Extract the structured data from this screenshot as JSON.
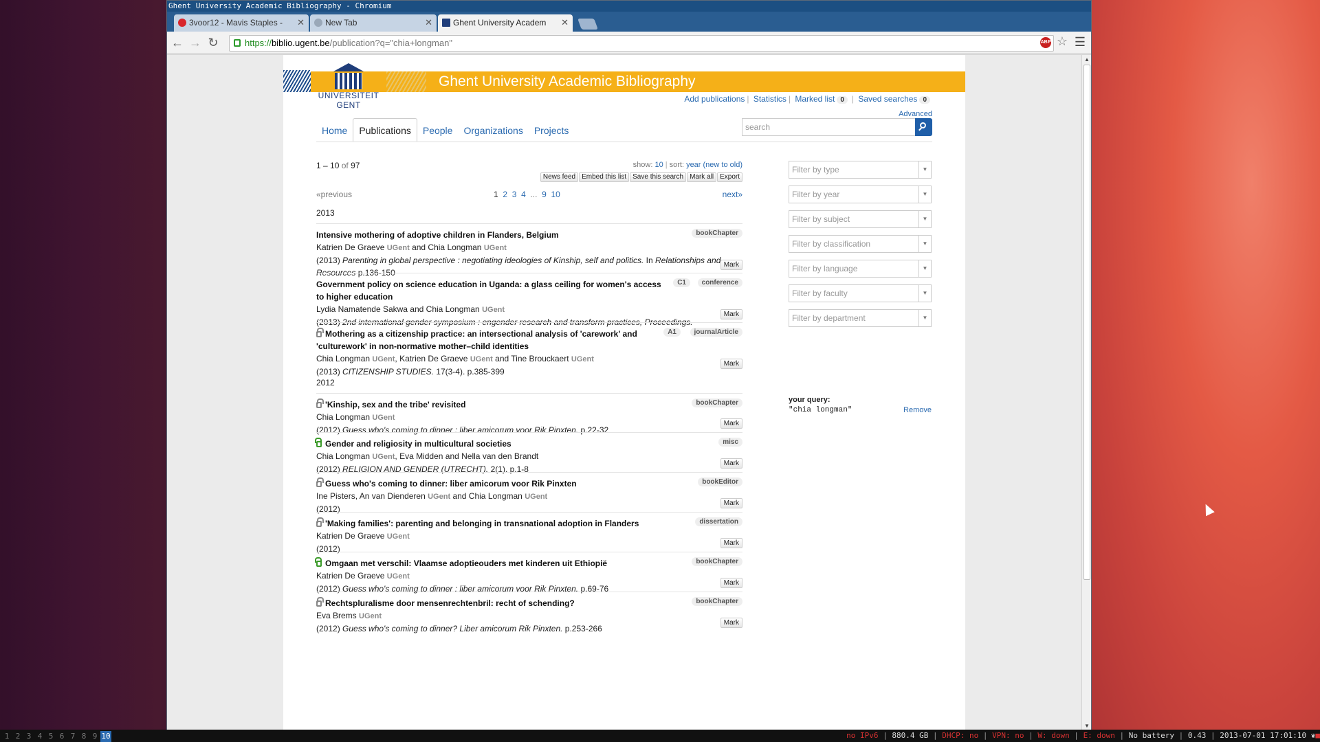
{
  "window": {
    "title": "Ghent University Academic Bibliography - Chromium"
  },
  "tabs": [
    {
      "label": "3voor12 - Mavis Staples -",
      "favicon_color": "#d8262c"
    },
    {
      "label": "New Tab",
      "favicon_color": "#9aa8b8"
    },
    {
      "label": "Ghent University Academ",
      "favicon_color": "#1f3d7a"
    }
  ],
  "omnibox": {
    "scheme": "https://",
    "host": "biblio.ugent.be",
    "path": "/publication?q=\"chia+longman\""
  },
  "site": {
    "title": "Ghent University Academic Bibliography",
    "logo_line1": "UNIVERSITEIT",
    "logo_line2": "GENT",
    "user_links": {
      "add": "Add publications",
      "stats": "Statistics",
      "marked": "Marked list",
      "marked_count": "0",
      "saved": "Saved searches",
      "saved_count": "0"
    },
    "advanced": "Advanced",
    "nav": [
      "Home",
      "Publications",
      "People",
      "Organizations",
      "Projects"
    ],
    "search_placeholder": "search"
  },
  "results": {
    "range_start": "1",
    "range_sep": " – ",
    "range_end": "10",
    "of": " of ",
    "total": "97",
    "show_label": "show:",
    "show_value": "10",
    "sort_label": "sort:",
    "sort_value": "year (new to old)",
    "buttons": [
      "News feed",
      "Embed this list",
      "Save this search",
      "Mark all",
      "Export"
    ],
    "pager": {
      "previous": "«previous",
      "next": "next»",
      "pages": [
        "1",
        "2",
        "3",
        "4",
        "...",
        "9",
        "10"
      ]
    },
    "mark_label": "Mark",
    "year_2013": "2013",
    "year_2012": "2012",
    "items": [
      {
        "title": "Intensive mothering of adoptive children in Flanders, Belgium",
        "authors": [
          [
            "Katrien De Graeve",
            "UGent"
          ],
          [
            " and Chia Longman",
            "UGent"
          ]
        ],
        "year": "(2013)",
        "source_italic": "Parenting in global perspective : negotiating ideologies of Kinship, self and politics.",
        "source_rest": " In ",
        "source_italic2": "Relationships and Resources",
        "pages": " p.136-150",
        "type": "bookChapter",
        "lock": "none"
      },
      {
        "title": "Government policy on science education in Uganda: a glass ceiling for women's access to higher education",
        "authors": [
          [
            "Lydia Namatende Sakwa and Chia Longman",
            "UGent"
          ]
        ],
        "year": "(2013)",
        "source_italic": "2nd international gender symposium : engender research and transform practices, Proceedings.",
        "type": "conference",
        "class": "C1",
        "lock": "none"
      },
      {
        "title": "Mothering as a citizenship practice: an intersectional analysis of 'carework' and 'culturework' in non-normative mother–child identities",
        "authors": [
          [
            "Chia Longman",
            "UGent"
          ],
          [
            ", Katrien De Graeve",
            "UGent"
          ],
          [
            " and Tine Brouckaert",
            "UGent"
          ]
        ],
        "year": "(2013)",
        "source_italic": "CITIZENSHIP STUDIES.",
        "pages": " 17(3-4). p.385-399",
        "type": "journalArticle",
        "class": "A1",
        "lock": "closed"
      },
      {
        "title": "'Kinship, sex and the tribe' revisited",
        "authors": [
          [
            "Chia Longman",
            "UGent"
          ]
        ],
        "year": "(2012)",
        "source_italic": "Guess who's coming to dinner : liber amicorum voor Rik Pinxten.",
        "pages": " p.22-32",
        "type": "bookChapter",
        "lock": "closed"
      },
      {
        "title": "Gender and religiosity in multicultural societies",
        "authors": [
          [
            "Chia Longman",
            "UGent"
          ],
          [
            ", Eva Midden and Nella van den Brandt",
            ""
          ]
        ],
        "year": "(2012)",
        "source_italic": "RELIGION AND GENDER (UTRECHT).",
        "pages": " 2(1). p.1-8",
        "type": "misc",
        "lock": "open"
      },
      {
        "title": "Guess who's coming to dinner: liber amicorum voor Rik Pinxten",
        "authors": [
          [
            "Ine Pisters, An van Dienderen",
            "UGent"
          ],
          [
            " and Chia Longman",
            "UGent"
          ]
        ],
        "year": "(2012)",
        "type": "bookEditor",
        "lock": "closed"
      },
      {
        "title": "'Making families': parenting and belonging in transnational adoption in Flanders",
        "authors": [
          [
            "Katrien De Graeve",
            "UGent"
          ]
        ],
        "year": "(2012)",
        "type": "dissertation",
        "lock": "closed"
      },
      {
        "title": "Omgaan met verschil: Vlaamse adoptieouders met kinderen uit Ethiopië",
        "authors": [
          [
            "Katrien De Graeve",
            "UGent"
          ]
        ],
        "year": "(2012)",
        "source_italic": "Guess who's coming to dinner : liber amicorum voor Rik Pinxten.",
        "pages": " p.69-76",
        "type": "bookChapter",
        "lock": "open"
      },
      {
        "title": "Rechtspluralisme door mensenrechtenbril: recht of schending?",
        "authors": [
          [
            "Eva Brems",
            "UGent"
          ]
        ],
        "year": "(2012)",
        "source_italic": "Guess who's coming to dinner? Liber amicorum Rik Pinxten.",
        "pages": " p.253-266",
        "type": "bookChapter",
        "lock": "closed"
      }
    ]
  },
  "filters": [
    "Filter by type",
    "Filter by year",
    "Filter by subject",
    "Filter by classification",
    "Filter by language",
    "Filter by faculty",
    "Filter by department"
  ],
  "query": {
    "label": "your query:",
    "value": "\"chia longman\"",
    "remove": "Remove"
  },
  "taskbar": {
    "workspaces": [
      "1",
      "2",
      "3",
      "4",
      "5",
      "6",
      "7",
      "8",
      "9",
      "10"
    ],
    "active_workspace": "10",
    "ipv6": "no IPv6",
    "disk": "880.4 GB",
    "dhcp": "DHCP: no",
    "vpn": "VPN: no",
    "wifi": "W: down",
    "eth": "E: down",
    "battery": "No battery",
    "load": "0.43",
    "datetime": "2013-07-01 17:01:10"
  }
}
